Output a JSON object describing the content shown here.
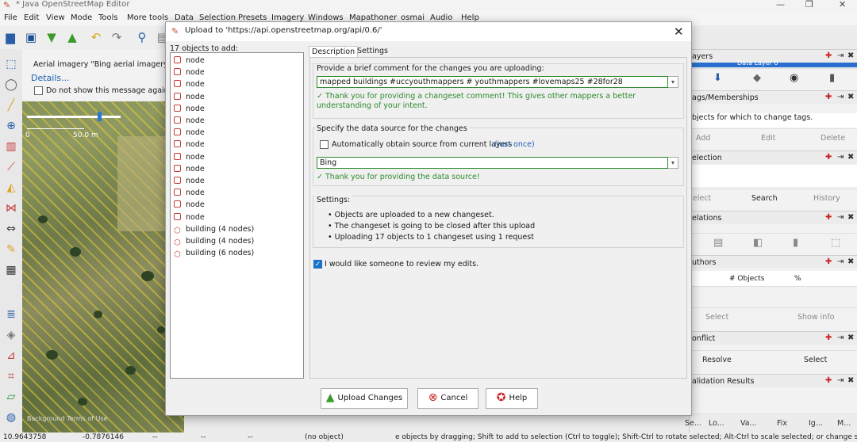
{
  "window": {
    "title": "* Java OpenStreetMap Editor"
  },
  "menu": [
    "File",
    "Edit",
    "View",
    "Mode",
    "Tools",
    "More tools",
    "Data",
    "Selection",
    "Presets",
    "Imagery",
    "Windows",
    "Mapathoner",
    "osmai",
    "Audio",
    "Help"
  ],
  "map": {
    "message": "Aerial imagery \"Bing aerial imagery\" r",
    "details_link": "Details...",
    "dont_show": "Do not show this message again",
    "scale_start": "0",
    "scale_label": "50.0 m",
    "attribution": "Background Terms of Use"
  },
  "dialog": {
    "title": "Upload to 'https://api.openstreetmap.org/api/0.6/'",
    "list_header": "17 objects to add:",
    "objects": [
      {
        "label": "node",
        "kind": "node"
      },
      {
        "label": "node",
        "kind": "node"
      },
      {
        "label": "node",
        "kind": "node"
      },
      {
        "label": "node",
        "kind": "node"
      },
      {
        "label": "node",
        "kind": "node"
      },
      {
        "label": "node",
        "kind": "node"
      },
      {
        "label": "node",
        "kind": "node"
      },
      {
        "label": "node",
        "kind": "node"
      },
      {
        "label": "node",
        "kind": "node"
      },
      {
        "label": "node",
        "kind": "node"
      },
      {
        "label": "node",
        "kind": "node"
      },
      {
        "label": "node",
        "kind": "node"
      },
      {
        "label": "node",
        "kind": "node"
      },
      {
        "label": "node",
        "kind": "node"
      },
      {
        "label": "building (4 nodes)",
        "kind": "way"
      },
      {
        "label": "building (4 nodes)",
        "kind": "way"
      },
      {
        "label": "building (6 nodes)",
        "kind": "way"
      }
    ],
    "tabs": [
      "Description",
      "Settings"
    ],
    "comment_prompt": "Provide a brief comment for the changes you are uploading:",
    "comment_value": "mapped buildings #uccyouthmappers  # youthmappers #lovemaps25 #28for28",
    "comment_thanks": "✓ Thank you for providing a changeset comment! This gives other mappers a better understanding of your intent.",
    "source_prompt": "Specify the data source for the changes",
    "auto_source": "Automatically obtain source from current layers",
    "just_once": "(just once)",
    "source_value": "Bing",
    "source_thanks": "✓ Thank you for providing the data source!",
    "settings_label": "Settings:",
    "settings_lines": [
      "Objects are uploaded to a new changeset.",
      "The changeset is going to be closed after this upload",
      "Uploading 17 objects to 1 changeset using 1 request"
    ],
    "review_label": "I would like someone to review my edits.",
    "review_checked": true,
    "buttons": {
      "upload": "Upload Changes",
      "cancel": "Cancel",
      "help": "Help"
    }
  },
  "right_panels": {
    "layers_title": "ayers",
    "layer_name": "Data Layer 0",
    "tags_title": "ags/Memberships",
    "tags_hint": "bjects for which to change tags.",
    "tags_buttons": [
      "Add",
      "Edit",
      "Delete"
    ],
    "selection_title": "election",
    "selection_buttons": [
      "elect",
      "Search",
      "History"
    ],
    "relations_title": "elations",
    "authors_title": "uthors",
    "authors_cols": [
      "# Objects",
      "%"
    ],
    "authors_buttons": [
      "Select",
      "Show info"
    ],
    "conflict_title": "onflict",
    "conflict_buttons": [
      "Resolve",
      "Select"
    ],
    "validation_title": "alidation Results",
    "bottom_tabs": [
      "Se...",
      "Lo...",
      "Va...",
      "Fix",
      "Ig...",
      "M..."
    ]
  },
  "status": {
    "lat": "10.9643758",
    "lon": "-0.7876146",
    "heading": "--",
    "angle": "--",
    "distance": "--",
    "object": "(no object)",
    "hint": "e objects by dragging; Shift to add to selection (Ctrl to toggle); Shift-Ctrl to rotate selected; Alt-Ctrl to scale selected; or change selection"
  },
  "colors": {
    "ok_green": "#2d8a2d",
    "accent_blue": "#1a73c8",
    "close_red": "#c82020"
  }
}
